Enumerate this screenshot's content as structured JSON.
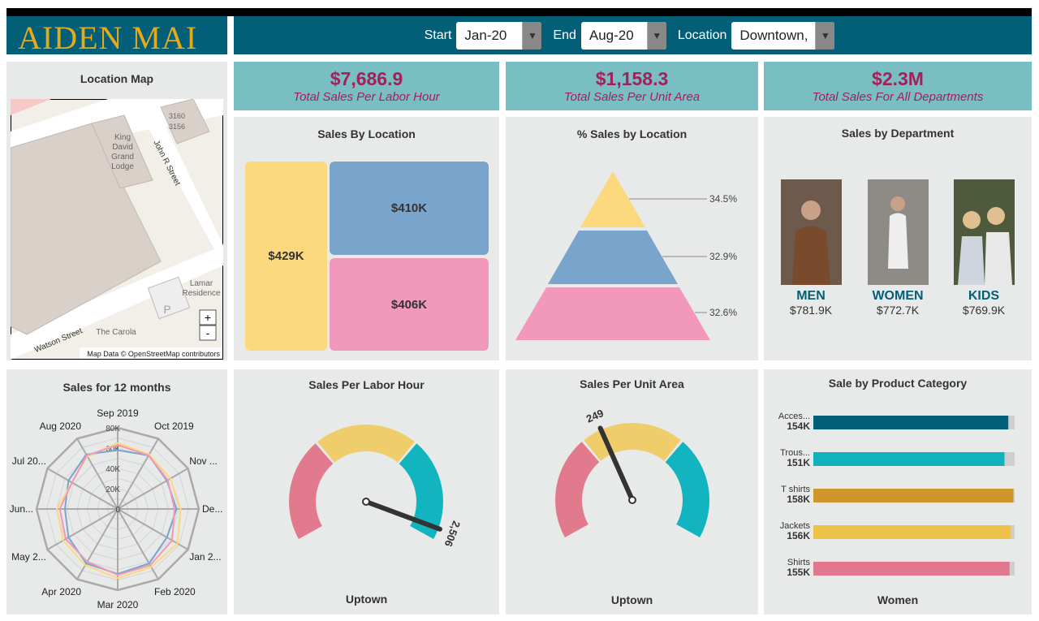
{
  "header": {
    "logo": "AIDEN MAI",
    "start_label": "Start",
    "start_value": "Jan-20",
    "end_label": "End",
    "end_value": "Aug-20",
    "location_label": "Location",
    "location_value": "Downtown,"
  },
  "map": {
    "title": "Location Map",
    "labels": [
      "3160",
      "3156",
      "King",
      "David",
      "Grand",
      "Lodge",
      "John R Street",
      "Lamar",
      "Residence",
      "The Carola",
      "Watson Street",
      "P"
    ],
    "zoom_in": "+",
    "zoom_out": "-",
    "attribution": "Map Data © OpenStreetMap contributors"
  },
  "kpis": [
    {
      "value": "$7,686.9",
      "label": "Total Sales Per Labor Hour"
    },
    {
      "value": "$1,158.3",
      "label": "Total Sales Per Unit Area"
    },
    {
      "value": "$2.3M",
      "label": "Total Sales For All Departments"
    }
  ],
  "colors": {
    "yellow": "#fcd97e",
    "blue": "#79a5cc",
    "pink": "#f298ba",
    "teal": "#035f78",
    "accent": "#a4205b"
  },
  "treemap": {
    "title": "Sales By Location",
    "items": [
      {
        "label": "$429K",
        "value": 429,
        "color": "#fcd97e"
      },
      {
        "label": "$410K",
        "value": 410,
        "color": "#79a5cc"
      },
      {
        "label": "$406K",
        "value": 406,
        "color": "#f298ba"
      }
    ]
  },
  "pyramid": {
    "title": "% Sales by Location",
    "items": [
      {
        "label": "34.5%",
        "color": "#fcd97e"
      },
      {
        "label": "32.9%",
        "color": "#79a5cc"
      },
      {
        "label": "32.6%",
        "color": "#f298ba"
      }
    ]
  },
  "departments": {
    "title": "Sales by Department",
    "items": [
      {
        "name": "MEN",
        "value": "$781.9K"
      },
      {
        "name": "WOMEN",
        "value": "$772.7K"
      },
      {
        "name": "KIDS",
        "value": "$769.9K"
      }
    ]
  },
  "chart_data": [
    {
      "type": "radar",
      "title": "Sales for 12 months",
      "categories": [
        "Sep 2019",
        "Oct 2019",
        "Nov ...",
        "De...",
        "Jan 2...",
        "Feb 2020",
        "Mar 2020",
        "Apr 2020",
        "May 2...",
        "Jun...",
        "Jul 20...",
        "Aug 2020"
      ],
      "ticks": [
        "0",
        "20K",
        "40K",
        "60K",
        "80K"
      ],
      "ylim": [
        0,
        80000
      ],
      "series": [
        {
          "color": "#79a5cc",
          "values": [
            58000,
            61000,
            56000,
            58000,
            56000,
            62000,
            64000,
            62000,
            56000,
            52000,
            56000,
            62000
          ]
        },
        {
          "color": "#fcd97e",
          "values": [
            65000,
            62000,
            60000,
            62000,
            68000,
            66000,
            68000,
            64000,
            62000,
            60000,
            52000,
            60000
          ]
        },
        {
          "color": "#f298ba",
          "values": [
            63000,
            61000,
            57000,
            56000,
            62000,
            64000,
            65000,
            60000,
            59000,
            57000,
            52000,
            61000
          ]
        }
      ]
    },
    {
      "type": "gauge",
      "title": "Sales Per Labor Hour",
      "value_label": "2,506",
      "needle_fraction": 0.96,
      "footer": "Uptown",
      "bands": [
        "#e27a8d",
        "#efcd6a",
        "#12b4c0"
      ]
    },
    {
      "type": "gauge",
      "title": "Sales Per Unit Area",
      "value_label": "249",
      "needle_fraction": 0.4,
      "footer": "Uptown",
      "bands": [
        "#e27a8d",
        "#efcd6a",
        "#12b4c0"
      ]
    },
    {
      "type": "bar",
      "title": "Sale by Product Category",
      "footer": "Women",
      "categories": [
        "Acces...",
        "Trous...",
        "T shirts",
        "Jackets",
        "Shirts"
      ],
      "value_labels": [
        "154K",
        "151K",
        "158K",
        "156K",
        "155K"
      ],
      "values": [
        154,
        151,
        158,
        156,
        155
      ],
      "xlim": [
        0,
        159
      ],
      "colors": [
        "#035f78",
        "#0fb2bd",
        "#d0962b",
        "#eec24a",
        "#e3778d"
      ]
    }
  ]
}
